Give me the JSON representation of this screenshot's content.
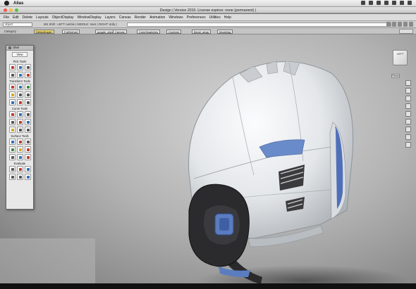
{
  "os_menubar": {
    "app_name": "Alias"
  },
  "window": {
    "title": "Design | Version 2010. License expires: none (permanent) |"
  },
  "menu": [
    "File",
    "Edit",
    "Delete",
    "Layouts",
    "ObjectDisplay",
    "WindowDisplay",
    "Layers",
    "Canvas",
    "Render",
    "Animation",
    "Windows",
    "Preferences",
    "Utilities",
    "Help"
  ],
  "toolbar": {
    "object_value": "object",
    "hint": "MS Shift : LEFT: tumble | MIDDLE: track | RIGHT: dolly |"
  },
  "shelfbar": {
    "category_label": "Category",
    "chips": [
      {
        "label": "DefaultLayer",
        "active": true
      },
      {
        "label": "FullHelmet",
        "active": false
      },
      {
        "label": "goggle_clips",
        "active": false
      },
      {
        "label": "Canvas",
        "active": false
      },
      {
        "label": "ColorSwatches",
        "active": false
      },
      {
        "label": "Conform",
        "active": false
      },
      {
        "label": "Bevel_strap",
        "active": false
      },
      {
        "label": "Modeling",
        "active": false
      }
    ]
  },
  "palette": {
    "title": "Shel",
    "tab": "View",
    "sections": [
      {
        "header": "Pick Tools",
        "tools": [
          "red",
          "blue",
          "gray",
          "gray",
          "blue",
          "red"
        ]
      },
      {
        "header": "Transform Tools",
        "tools": [
          "red",
          "blue",
          "green",
          "yellow",
          "gray",
          "gray",
          "blue",
          "red",
          "gray"
        ]
      },
      {
        "header": "Curve Tools",
        "tools": [
          "red",
          "blue",
          "gray",
          "gray",
          "red",
          "blue",
          "yellow",
          "gray",
          "gray"
        ]
      },
      {
        "header": "Surface Tools",
        "tools": [
          "blue",
          "red",
          "gray",
          "green",
          "yellow",
          "red",
          "gray",
          "blue",
          "red"
        ]
      },
      {
        "header": "Evaluate",
        "tools": [
          "gray",
          "red",
          "blue",
          "gray",
          "gray",
          "blue"
        ]
      }
    ]
  },
  "viewport": {
    "view_label": "LEFT",
    "show_button": "Show"
  },
  "colors": {
    "helmet_shell": "#e6e9eb",
    "visor_accent": "#5b7dbf",
    "ear_pad": "#2b2b2e",
    "background": "#b3b3b3"
  }
}
